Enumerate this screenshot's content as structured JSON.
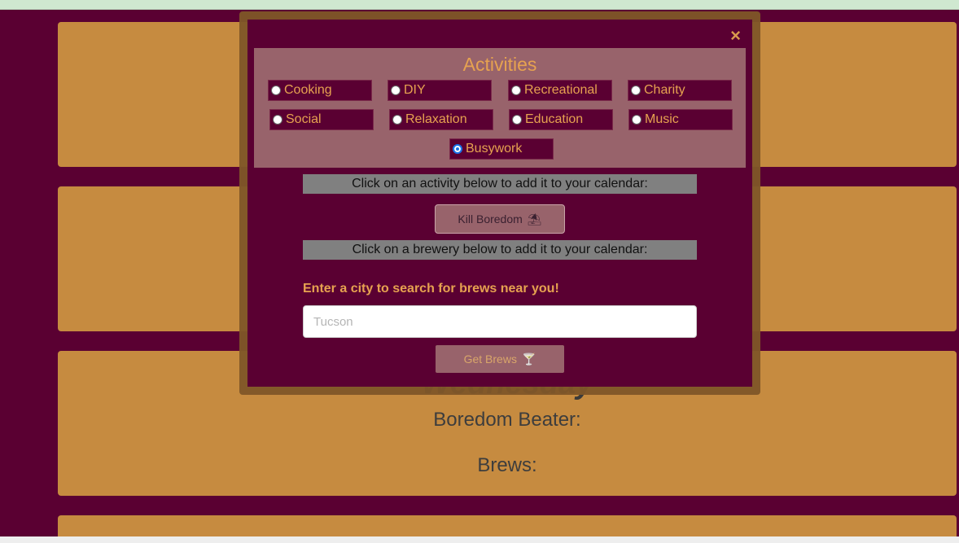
{
  "calendar": {
    "day3": {
      "title": "Wednesday",
      "boredom_label": "Boredom Beater:",
      "brews_label": "Brews:"
    }
  },
  "modal": {
    "close_icon": "×",
    "activities": {
      "title": "Activities",
      "options": [
        {
          "label": "Cooking",
          "checked": false
        },
        {
          "label": "DIY",
          "checked": false
        },
        {
          "label": "Recreational",
          "checked": false
        },
        {
          "label": "Charity",
          "checked": false
        },
        {
          "label": "Social",
          "checked": false
        },
        {
          "label": "Relaxation",
          "checked": false
        },
        {
          "label": "Education",
          "checked": false
        },
        {
          "label": "Music",
          "checked": false
        },
        {
          "label": "Busywork",
          "checked": true
        }
      ]
    },
    "activity_info": "Click on an activity below to add it to your calendar:",
    "kill_button": {
      "label": "Kill Boredom",
      "icon": "⛱"
    },
    "brewery_info": "Click on a brewery below to add it to your calendar:",
    "city_prompt": "Enter a city to search for brews near you!",
    "city_input": {
      "value": "",
      "placeholder": "Tucson"
    },
    "brews_button": {
      "label": "Get Brews",
      "icon": "🍸"
    }
  },
  "colors": {
    "background": "#5a0032",
    "card": "#c68b40",
    "accent_text": "#e6a250",
    "panel": "#98636b"
  }
}
